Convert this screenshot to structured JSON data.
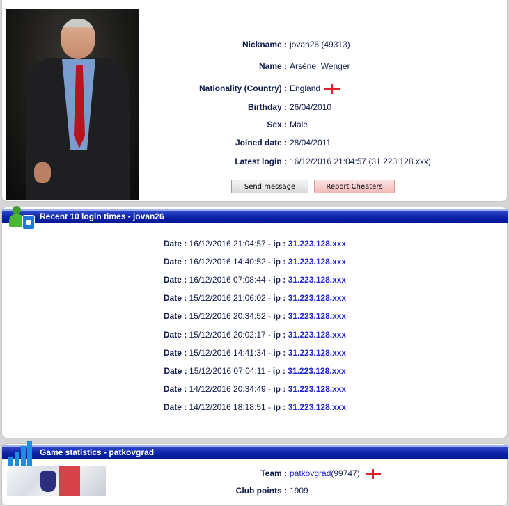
{
  "profile": {
    "photo_alt": "Arsène Wenger portrait",
    "rows": [
      {
        "label": "Nickname :",
        "value": "jovan26 (49313)"
      },
      {
        "label": "Name :",
        "value": "Arsène  Wenger"
      },
      {
        "label": "Nationality (Country) :",
        "value": "England"
      },
      {
        "label": "Birthday :",
        "value": "26/04/2010"
      },
      {
        "label": "Sex :",
        "value": "Male"
      },
      {
        "label": "Joined date :",
        "value": "28/04/2011"
      },
      {
        "label": "Latest login :",
        "value": "16/12/2016 21:04:57 (31.223.128.xxx)"
      }
    ],
    "send_message_label": "Send message",
    "report_label": "Report Cheaters"
  },
  "logins": {
    "title": "Recent 10 login times - jovan26",
    "date_label": "Date :",
    "ip_label": "ip :",
    "entries": [
      {
        "date": "16/12/2016 21:04:57",
        "ip": "31.223.128.xxx"
      },
      {
        "date": "16/12/2016 14:40:52",
        "ip": "31.223.128.xxx"
      },
      {
        "date": "16/12/2016 07:08:44",
        "ip": "31.223.128.xxx"
      },
      {
        "date": "15/12/2016 21:06:02",
        "ip": "31.223.128.xxx"
      },
      {
        "date": "15/12/2016 20:34:52",
        "ip": "31.223.128.xxx"
      },
      {
        "date": "15/12/2016 20:02:17",
        "ip": "31.223.128.xxx"
      },
      {
        "date": "15/12/2016 14:41:34",
        "ip": "31.223.128.xxx"
      },
      {
        "date": "15/12/2016 07:04:11",
        "ip": "31.223.128.xxx"
      },
      {
        "date": "14/12/2016 20:34:49",
        "ip": "31.223.128.xxx"
      },
      {
        "date": "14/12/2016 18:18:51",
        "ip": "31.223.128.xxx"
      }
    ]
  },
  "stats": {
    "title": "Game statistics - patkovgrad",
    "team_label": "Team :",
    "team_name": "patkovgrad",
    "team_id": "(99747)",
    "club_points_label": "Club points :",
    "club_points": "1909"
  },
  "icons": {
    "flag": "england-flag-icon",
    "logins_section": "user-lock-icon",
    "stats_section": "bar-chart-icon"
  },
  "colors": {
    "section_bar": "#0a21a8",
    "ip_link": "#1f23d6",
    "flag_red": "#e0202b",
    "report_button": "#f4b9b9"
  }
}
